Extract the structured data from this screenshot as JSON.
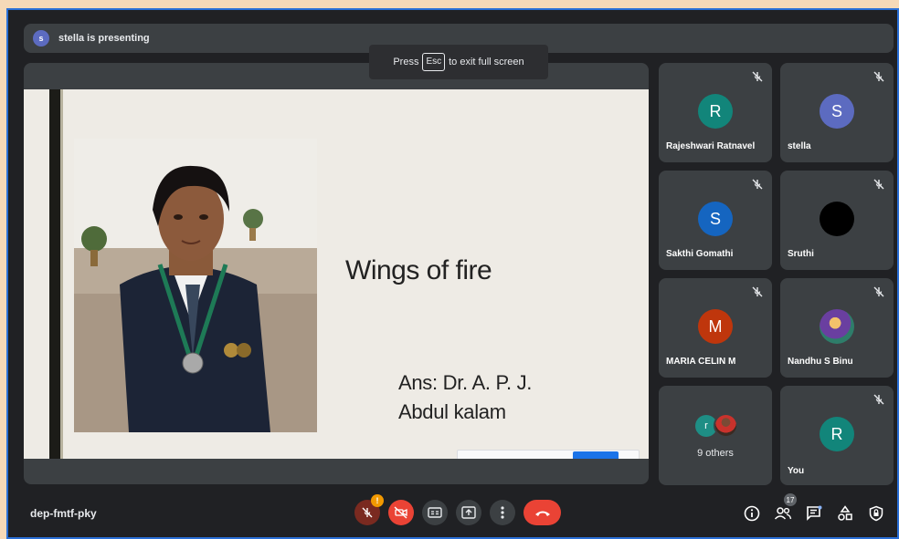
{
  "presenting": {
    "avatar_letter": "s",
    "text": "stella is presenting"
  },
  "fullscreen_toast": {
    "prefix": "Press",
    "key": "Esc",
    "suffix": "to exit full screen"
  },
  "slide": {
    "title": "Wings of fire",
    "answer_line1": "Ans: Dr. A. P. J.",
    "answer_line2": "Abdul kalam"
  },
  "participants": [
    {
      "name": "Rajeshwari Ratnavel",
      "initial": "R",
      "color": "#12857a",
      "muted": true
    },
    {
      "name": "stella",
      "initial": "S",
      "color": "#5c6bc0",
      "muted": true
    },
    {
      "name": "Sakthi Gomathi",
      "initial": "S",
      "color": "#1565c0",
      "muted": true
    },
    {
      "name": "Sruthi",
      "initial": "",
      "color": "#000000",
      "muted": true
    },
    {
      "name": "MARIA CELIN M",
      "initial": "M",
      "color": "#bf360c",
      "muted": true
    },
    {
      "name": "Nandhu S Binu",
      "initial": "",
      "color": "#7e57c2",
      "muted": true
    },
    {
      "name": "You",
      "initial": "R",
      "color": "#12857a",
      "muted": true
    }
  ],
  "others_tile": {
    "avatar_letter": "r",
    "label": "9 others"
  },
  "bottom_bar": {
    "meeting_code": "dep-fmtf-pky",
    "mic_alert_badge": "!",
    "people_count": "17"
  }
}
